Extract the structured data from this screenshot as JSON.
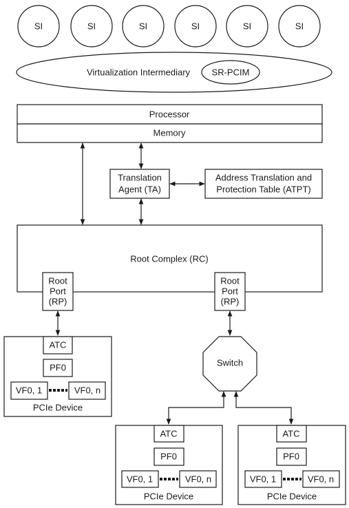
{
  "system_images": [
    "SI",
    "SI",
    "SI",
    "SI",
    "SI",
    "SI"
  ],
  "virtualization_intermediary": "Virtualization Intermediary",
  "sr_pcim": "SR-PCIM",
  "processor": "Processor",
  "memory": "Memory",
  "translation_agent": [
    "Translation",
    "Agent (TA)"
  ],
  "atpt": [
    "Address Translation and",
    "Protection Table (ATPT)"
  ],
  "root_complex": "Root Complex (RC)",
  "root_port": [
    "Root",
    "Port",
    "(RP)"
  ],
  "switch": "Switch",
  "device": {
    "atc": "ATC",
    "pf": "PF0",
    "vf_first": "VF0, 1",
    "vf_last": "VF0, n",
    "label": "PCIe Device"
  }
}
